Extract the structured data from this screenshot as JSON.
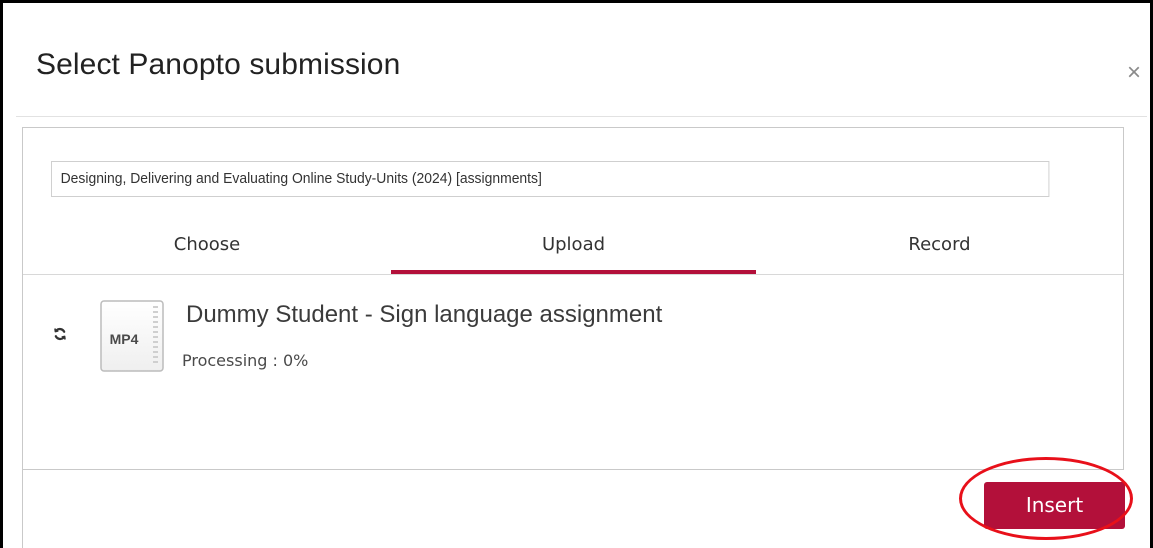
{
  "dialog": {
    "title": "Select Panopto submission",
    "close_symbol": "×"
  },
  "folder": {
    "value": "Designing, Delivering and Evaluating Online Study-Units (2024) [assignments]"
  },
  "tabs": [
    {
      "label": "Choose",
      "active": false
    },
    {
      "label": "Upload",
      "active": true
    },
    {
      "label": "Record",
      "active": false
    }
  ],
  "upload": {
    "file_type": "MP4",
    "file_name": "Dummy Student - Sign language assignment",
    "status": "Processing : 0%",
    "progress_percent": 0,
    "status_icon": "refresh-icon"
  },
  "footer": {
    "insert_label": "Insert"
  },
  "colors": {
    "accent": "#b3103a",
    "annotation": "#e8101a"
  }
}
